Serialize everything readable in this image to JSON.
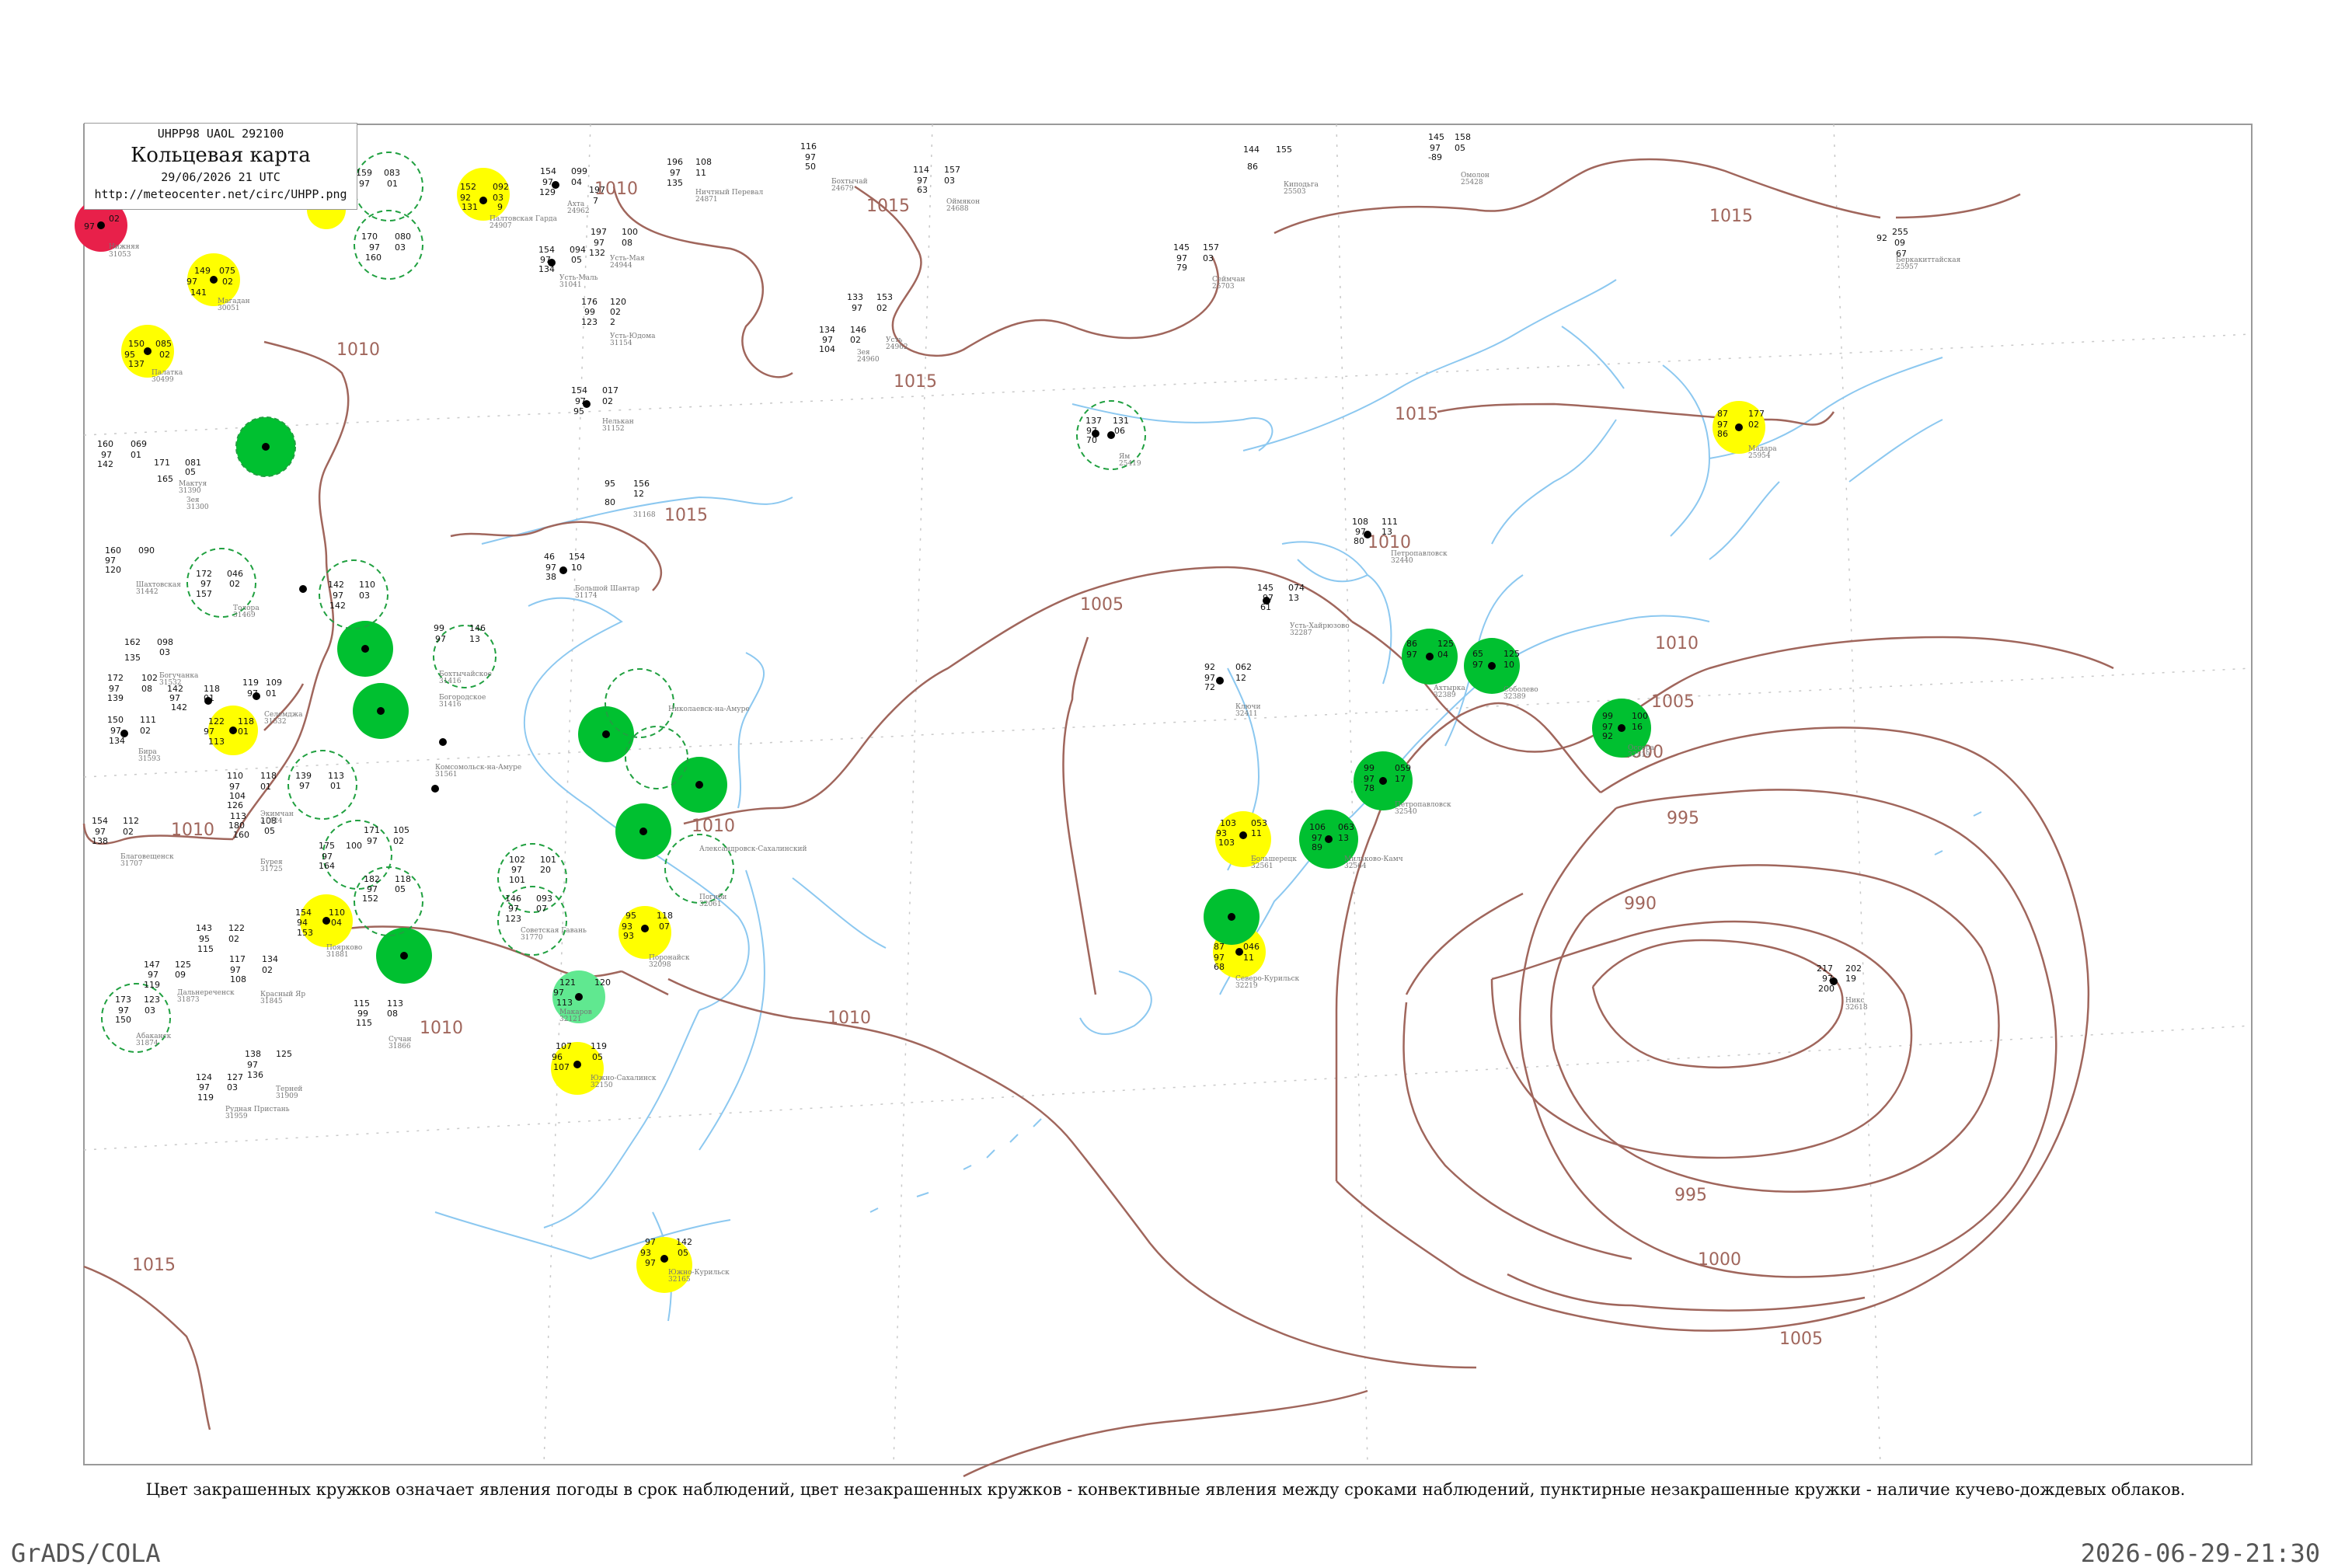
{
  "title_box": {
    "code": "UHPP98 UAOL 292100",
    "title": "Кольцевая карта",
    "datetime": "29/06/2026 21 UTC",
    "url": "http://meteocenter.net/circ/UHPP.png"
  },
  "legend_text": "Цвет закрашенных кружков означает явления погоды в срок наблюдений, цвет незакрашенных кружков - конвективные явления между сроками наблюдений, пунктирные незакрашенные кружки - наличие кучево-дождевых облаков.",
  "footer": {
    "left": "GrADS/COLA",
    "right": "2026-06-29-21:30"
  },
  "colors": {
    "isobar": "#a0665c",
    "coast": "#8cc8f0",
    "yellow": "#ffff00",
    "green": "#00c030",
    "light_green": "#60e890",
    "red": "#e8204a",
    "dash_green": "#20a040"
  },
  "isobars": [
    "1015",
    "1015",
    "1015",
    "1015",
    "1015",
    "1010",
    "1010",
    "1010",
    "1010",
    "1010",
    "1005",
    "1005",
    "1005",
    "1000",
    "1000",
    "995",
    "995",
    "990",
    "1010",
    "1015",
    "1010",
    "1010"
  ],
  "stations": [
    {
      "id": "s1",
      "color": "red",
      "filled": true,
      "name": "Нижняя"
    },
    {
      "id": "s2",
      "color": "yellow",
      "filled": true,
      "name": "Усть-Камчатск"
    },
    {
      "id": "s3",
      "color": "yellow",
      "filled": true,
      "name": "Магадан"
    },
    {
      "id": "s4",
      "color": "yellow",
      "filled": true,
      "name": "Палатка"
    },
    {
      "id": "s5",
      "color": "green",
      "filled": true,
      "name": "Эвенск"
    },
    {
      "id": "s6",
      "color": "green",
      "filled": true,
      "name": "Северо-Курильск"
    },
    {
      "id": "s7",
      "color": "green",
      "filled": true,
      "name": "Петропавловск"
    },
    {
      "id": "s8",
      "color": "green",
      "filled": true,
      "name": "Никольское"
    },
    {
      "id": "s9",
      "color": "yellow",
      "filled": true,
      "name": "Ключи"
    },
    {
      "id": "s10",
      "color": "yellow",
      "filled": true,
      "name": "Охотск"
    },
    {
      "id": "s11",
      "color": "light_green",
      "filled": true,
      "name": "Аян"
    },
    {
      "id": "s12",
      "color": "yellow",
      "filled": true,
      "name": "Южно-Сахалинск"
    }
  ]
}
